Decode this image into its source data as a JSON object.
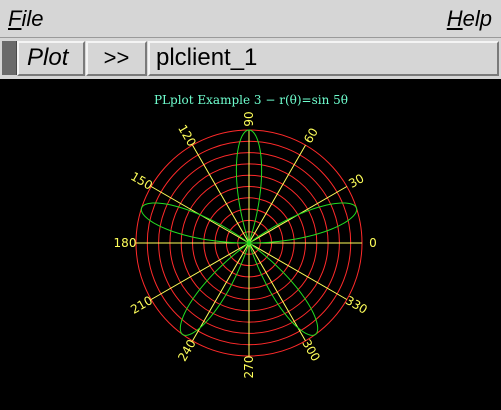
{
  "menubar": {
    "file_label": "File",
    "help_label": "Help"
  },
  "toolbar": {
    "plot_label": "Plot",
    "next_label": ">>",
    "window_name": "plclient_1"
  },
  "plot": {
    "title": "PLplot Example 3 − r(θ)=sin 5θ",
    "angle_labels": [
      "0",
      "30",
      "60",
      "90",
      "120",
      "150",
      "180",
      "210",
      "240",
      "270",
      "300",
      "330"
    ],
    "colors": {
      "background": "#000000",
      "circles": "#ff2a2a",
      "spokes": "#ffff5a",
      "labels": "#ffff5a",
      "curve": "#22dd22",
      "title": "#6fffcf"
    }
  },
  "chart_data": {
    "type": "line",
    "title": "PLplot Example 3 − r(θ)=sin 5θ",
    "coordinate_system": "polar",
    "function": "r(θ) = sin(5θ)",
    "theta_ticks_deg": [
      0,
      30,
      60,
      90,
      120,
      150,
      180,
      210,
      240,
      270,
      300,
      330
    ],
    "r_circles": [
      0.1,
      0.2,
      0.3,
      0.4,
      0.5,
      0.6,
      0.7,
      0.8,
      0.9,
      1.0
    ],
    "r_range": [
      0,
      1
    ],
    "series": [
      {
        "name": "",
        "values": "r = sin(5θ), θ in [0°, 360°]"
      }
    ]
  }
}
